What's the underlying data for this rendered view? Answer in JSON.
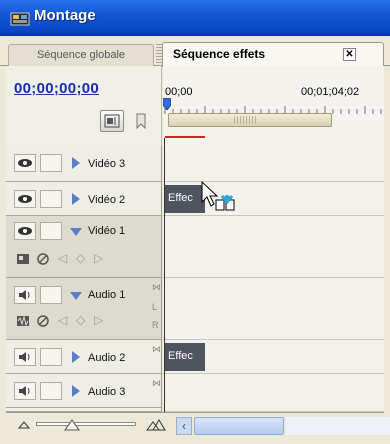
{
  "window": {
    "title": "Montage"
  },
  "tabs": [
    {
      "label": "Séquence globale",
      "active": false
    },
    {
      "label": "Séquence effets",
      "active": true,
      "close": "✕"
    }
  ],
  "timeline": {
    "timecode": "00;00;00;00",
    "ruler_labels": [
      "00;00",
      "00;01;04;02"
    ]
  },
  "tracks": [
    {
      "name": "Vidéo 3",
      "type": "video",
      "expanded": false
    },
    {
      "name": "Vidéo 2",
      "type": "video",
      "expanded": false
    },
    {
      "name": "Vidéo 1",
      "type": "video",
      "expanded": true
    },
    {
      "name": "Audio 1",
      "type": "audio",
      "expanded": true,
      "channel_marks": [
        "L",
        "R"
      ]
    },
    {
      "name": "Audio 2",
      "type": "audio",
      "expanded": false
    },
    {
      "name": "Audio 3",
      "type": "audio",
      "expanded": false
    }
  ],
  "clips": [
    {
      "track": "Vidéo 2",
      "label": "Effec"
    },
    {
      "track": "Audio 2",
      "label": "Effec"
    }
  ],
  "colors": {
    "titlebar": "#1458d6",
    "timecode": "#1a2fa8",
    "clip": "#4f555f",
    "track_arrow": "#5b7fc2"
  }
}
